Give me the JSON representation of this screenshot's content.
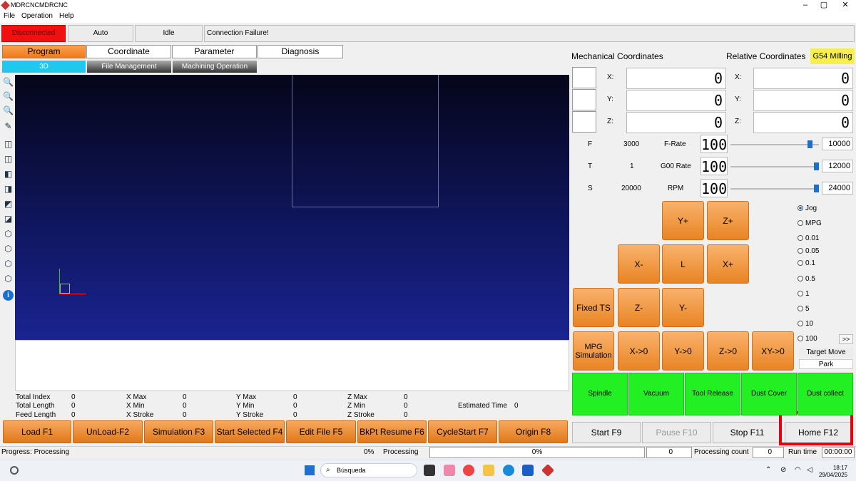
{
  "window": {
    "title": "MDRCNCMDRCNC",
    "min": "–",
    "max": "▢",
    "close": "✕"
  },
  "menu": [
    "File",
    "Operation",
    "Help"
  ],
  "status_row": {
    "connection": "Disconnected",
    "mode": "Auto",
    "state": "Idle",
    "message": "Connection Failure!"
  },
  "tabs": [
    "Program",
    "Coordinate",
    "Parameter",
    "Diagnosis"
  ],
  "subtabs": [
    "3D",
    "File Management",
    "Machining Operation"
  ],
  "stats": {
    "total_index_label": "Total Index",
    "total_index": "0",
    "total_length_label": "Total Length",
    "total_length": "0",
    "feed_length_label": "Feed Length",
    "feed_length": "0",
    "xmax_label": "X Max",
    "xmax": "0",
    "xmin_label": "X Min",
    "xmin": "0",
    "xstroke_label": "X Stroke",
    "xstroke": "0",
    "ymax_label": "Y Max",
    "ymax": "0",
    "ymin_label": "Y Min",
    "ymin": "0",
    "ystroke_label": "Y Stroke",
    "ystroke": "0",
    "zmax_label": "Z Max",
    "zmax": "0",
    "zmin_label": "Z Min",
    "zmin": "0",
    "zstroke_label": "Z Stroke",
    "zstroke": "0",
    "est_time_label": "Estimated Time",
    "est_time": "0"
  },
  "buttons_bottom": [
    "Load F1",
    "UnLoad-F2",
    "Simulation F3",
    "Start Selected F4",
    "Edit File F5",
    "BkPt Resume F6",
    "CycleStart F7",
    "Origin F8"
  ],
  "buttons_right_bottom": [
    "Start F9",
    "Pause F10",
    "Stop F11",
    "Home F12"
  ],
  "statusbar": {
    "progress": "Progress: Processing",
    "percent": "0%",
    "processing": "Processing",
    "bar_text": "0%",
    "count_box": "0",
    "count_label": "Processing count",
    "count": "0",
    "runtime_label": "Run time",
    "runtime": "00:00:00"
  },
  "coords": {
    "mech_header": "Mechanical Coordinates",
    "rel_header": "Relative Coordinates",
    "wcs": "G54 Milling",
    "x_label": "X:",
    "y_label": "Y:",
    "z_label": "Z:",
    "mech_x": "0",
    "mech_y": "0",
    "mech_z": "0",
    "rel_x": "0",
    "rel_y": "0",
    "rel_z": "0"
  },
  "rates": {
    "f_label": "F",
    "f_value": "3000",
    "f_name": "F-Rate",
    "f_override": "100",
    "f_max": "10000",
    "f_level": 0.92,
    "t_label": "T",
    "t_value": "1",
    "t_name": "G00 Rate",
    "t_override": "100",
    "t_max": "12000",
    "t_level": 1.0,
    "s_label": "S",
    "s_value": "20000",
    "s_name": "RPM",
    "s_override": "100",
    "s_max": "24000",
    "s_level": 1.0
  },
  "jog_buttons": {
    "yplus": "Y+",
    "zplus": "Z+",
    "xminus": "X-",
    "l": "L",
    "xplus": "X+",
    "fixed_ts": "Fixed TS",
    "zminus": "Z-",
    "yminus": "Y-",
    "mpg_sim": "MPG Simulation",
    "x0": "X->0",
    "y0": "Y->0",
    "z0": "Z->0",
    "xy0": "XY->0"
  },
  "jog_modes": {
    "jog": "Jog",
    "mpg": "MPG"
  },
  "step_options": [
    "0.01",
    "0.05",
    "0.1",
    "0.5",
    "1",
    "5",
    "10",
    "100"
  ],
  "more_label": ">>",
  "target_move": "Target Move",
  "park": "Park",
  "green_buttons": [
    "Spindle",
    "Vacuum",
    "Tool Release",
    "Dust Cover",
    "Dust collect"
  ],
  "taskbar": {
    "search": "Búsqueda",
    "time": "18:17",
    "date": "29/04/2025"
  },
  "colors": {
    "disconnected": "#f01010",
    "accent_orange": "#f08a2a",
    "highlight": "#e8000d",
    "green": "#22f022"
  }
}
